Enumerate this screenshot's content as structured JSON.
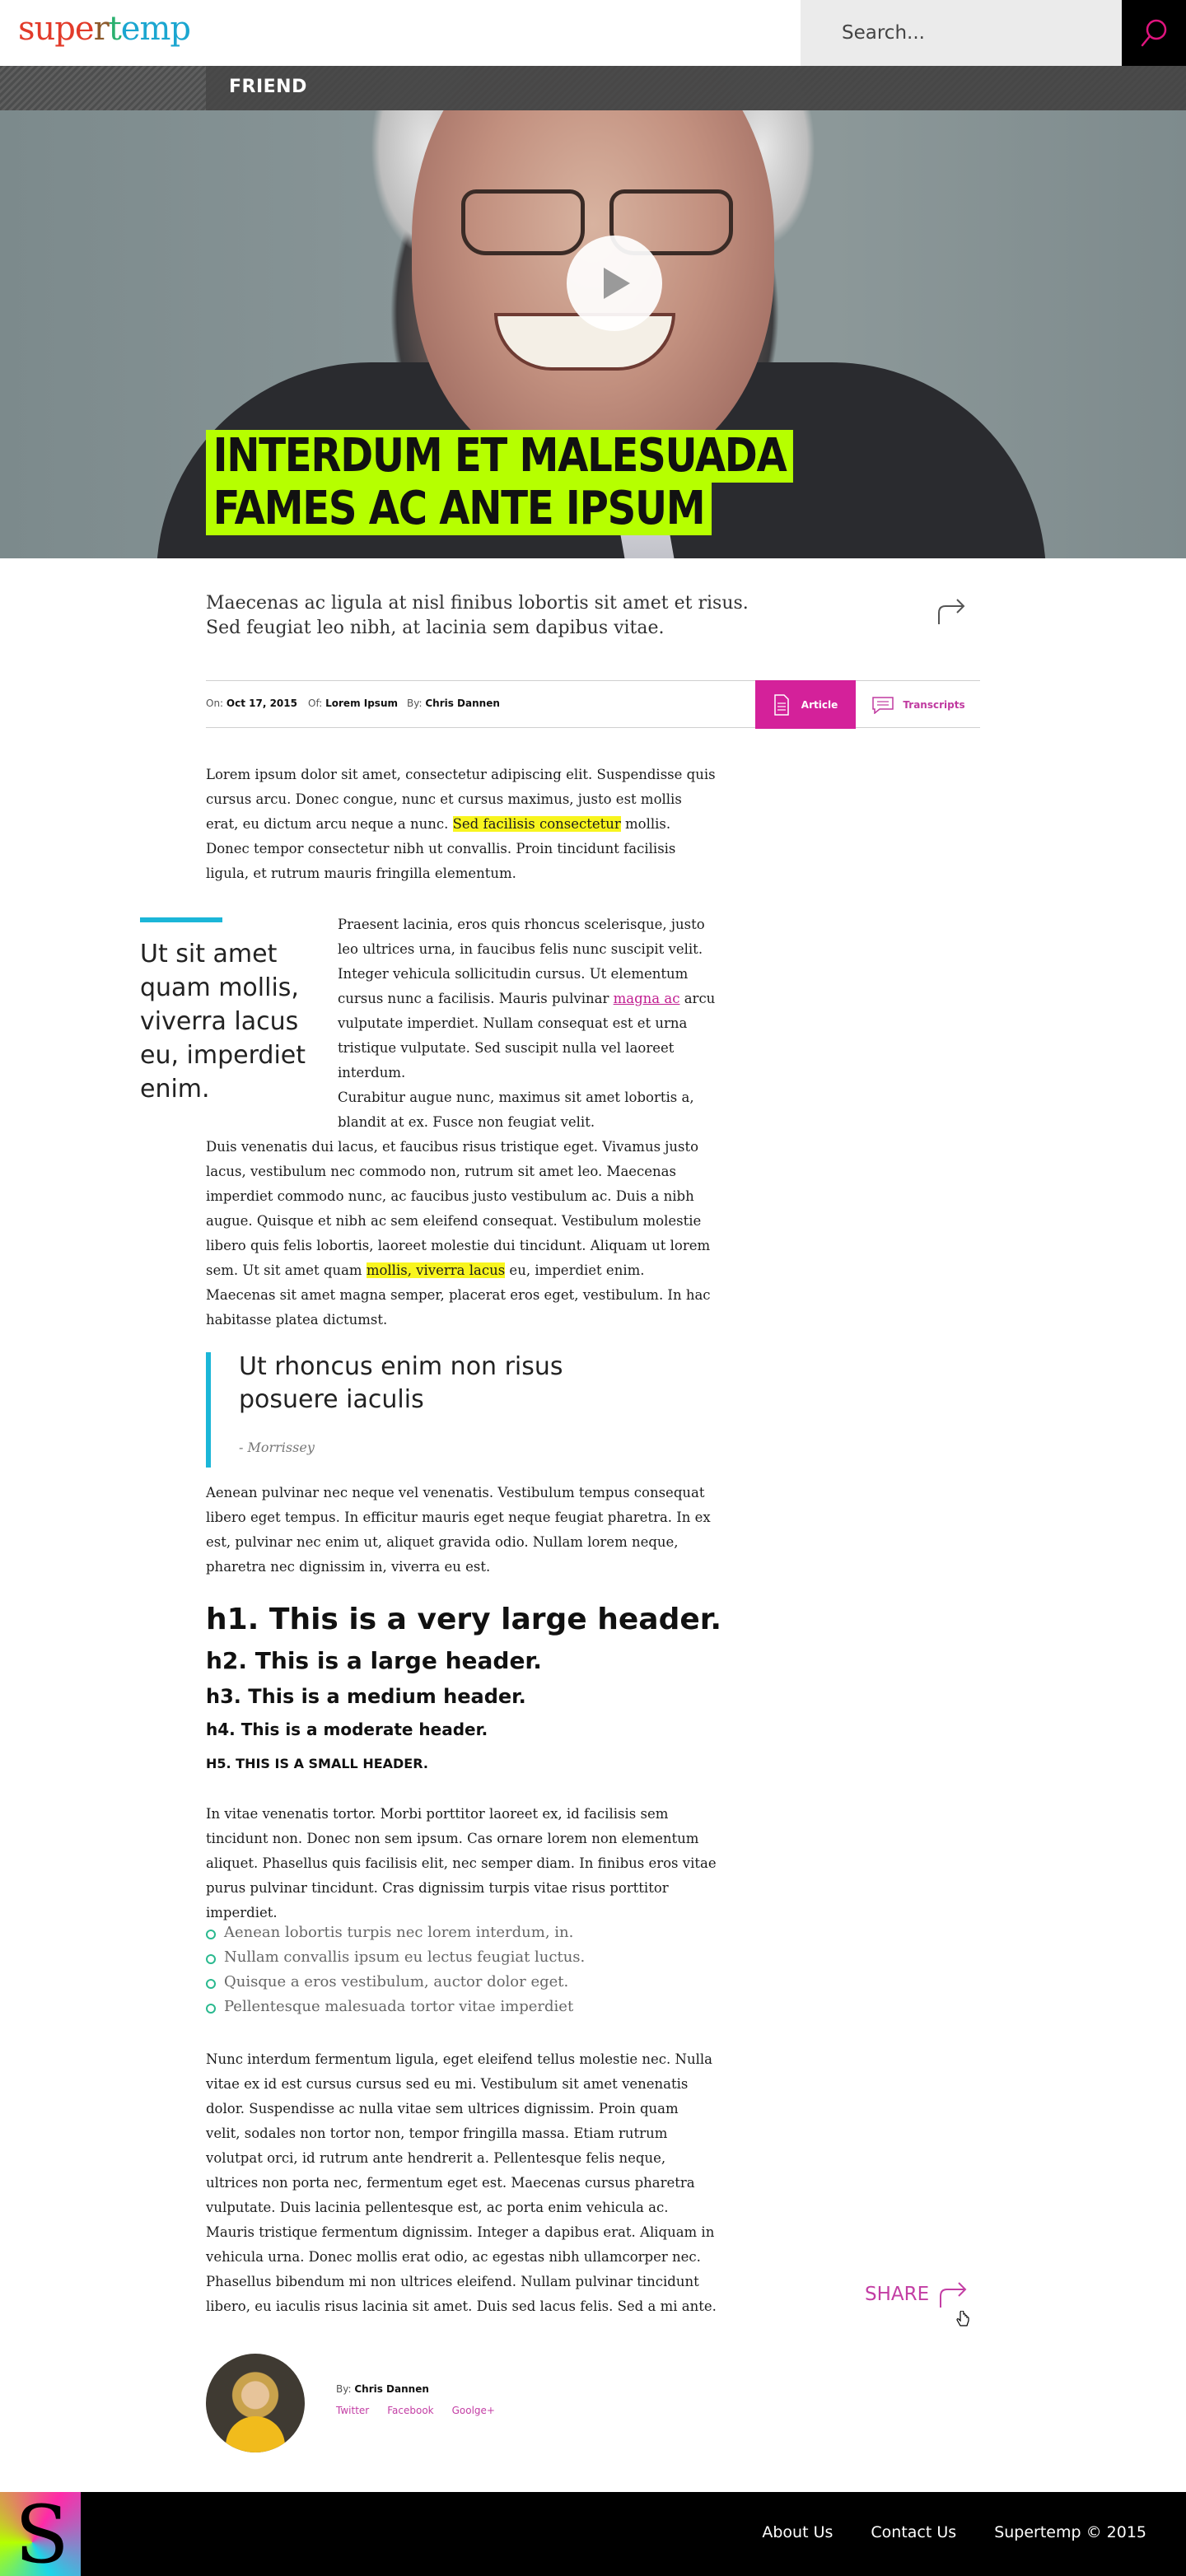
{
  "header": {
    "logo": {
      "text": "supertemp",
      "letters": [
        {
          "ch": "s",
          "color": "#e23b2a"
        },
        {
          "ch": "u",
          "color": "#e23b2a"
        },
        {
          "ch": "p",
          "color": "#e23b2a"
        },
        {
          "ch": "e",
          "color": "#e23b2a"
        },
        {
          "ch": "r",
          "color": "#8c5a2c"
        },
        {
          "ch": "t",
          "color": "#2ab06f"
        },
        {
          "ch": "e",
          "color": "#1ba6d0"
        },
        {
          "ch": "m",
          "color": "#1ba6d0"
        },
        {
          "ch": "p",
          "color": "#1ba6d0"
        }
      ]
    },
    "search_placeholder": "Search...",
    "search_icon": "search-icon",
    "search_icon_color": "#e0147e"
  },
  "hero": {
    "tag": "FRIEND",
    "headline_lines": [
      "INTERDUM ET MALESUADA",
      "FAMES AC ANTE IPSUM"
    ],
    "headline_bg": "#b6ff00",
    "play_icon": "play-icon"
  },
  "intro": {
    "text": "Maecenas ac ligula at nisl finibus lobortis sit amet et risus. Sed feugiat leo nibh, at lacinia sem dapibus vitae.",
    "share_icon": "share-arrow-icon"
  },
  "meta": {
    "on_label": "On:",
    "on_value": "Oct 17, 2015",
    "of_label": "Of:",
    "of_value": "Lorem Ipsum",
    "by_label": "By:",
    "by_value": "Chris Dannen",
    "tabs": {
      "article": "Article",
      "transcripts": "Transcripts"
    },
    "accent": "#d4219a"
  },
  "article": {
    "p1": {
      "before": "Lorem ipsum dolor sit amet, consectetur adipiscing elit. Suspendisse quis cursus arcu. Donec congue, nunc et cursus maximus, justo est mollis erat, eu dictum arcu neque a nunc. ",
      "highlight": "Sed facilisis consectetur",
      "after": " mollis. Donec tempor consectetur nibh ut convallis. Proin tincidunt facilisis ligula, et rutrum mauris fringilla elementum."
    },
    "pullquote": "Ut sit amet quam mollis, viverra lacus eu, imperdiet enim.",
    "p2": {
      "before": "Praesent lacinia, eros quis rhoncus scelerisque, justo leo ultrices urna, in faucibus felis nunc suscipit velit. Integer vehicula sollicitudin cursus. Ut elementum cursus nunc a facilisis. Mauris pulvinar ",
      "link": "magna ac",
      "after": " arcu vulputate imperdiet. Nullam consequat est et urna tristique vulputate. Sed suscipit nulla vel laoreet interdum."
    },
    "p3": {
      "intro": "Curabitur augue nunc, maximus sit amet lobortis a, blandit at ex. Fusce non feugiat velit.",
      "before": "Duis venenatis dui lacus, et faucibus risus tristique eget. Vivamus justo lacus, vestibulum nec commodo non, rutrum sit amet leo. Maecenas imperdiet commodo nunc, ac faucibus justo vestibulum ac. Duis a nibh augue. Quisque et nibh ac sem eleifend consequat. Vestibulum molestie libero quis felis lobortis, laoreet molestie dui tincidunt. Aliquam ut lorem sem. Ut sit amet quam ",
      "highlight": "mollis, viverra lacus",
      "after": " eu, imperdiet enim. Maecenas sit amet magna semper, placerat eros eget, vestibulum. In hac habitasse platea dictumst."
    },
    "blockquote": {
      "text": "Ut rhoncus enim non risus posuere iaculis",
      "cite": "- Morrissey"
    },
    "p4": "Aenean pulvinar nec neque vel venenatis. Vestibulum tempus consequat libero eget tempus. In efficitur mauris eget neque feugiat pharetra. In ex est, pulvinar nec enim ut, aliquet gravida odio. Nullam lorem neque, pharetra nec dignissim in, viverra eu est.",
    "headers": {
      "h1": "h1. This is a very large header.",
      "h2": "h2. This is a large header.",
      "h3": "h3. This is a medium header.",
      "h4": "h4. This is a moderate header.",
      "h5": "h5. This is a small header."
    },
    "p5": "In vitae venenatis tortor. Morbi porttitor laoreet ex, id facilisis sem tincidunt non. Donec non sem ipsum. Cas ornare lorem non elementum aliquet. Phasellus quis facilisis elit, nec semper diam. In finibus eros vitae purus pulvinar tincidunt. Cras dignissim turpis vitae risus porttitor imperdiet.",
    "list": [
      "Aenean lobortis turpis nec lorem interdum, in.",
      "Nullam convallis ipsum eu lectus feugiat luctus.",
      "Quisque a eros vestibulum, auctor dolor eget.",
      "Pellentesque malesuada tortor vitae imperdiet"
    ],
    "p6": "Nunc interdum fermentum ligula, eget eleifend tellus molestie nec. Nulla vitae ex id est cursus cursus sed eu mi. Vestibulum sit amet venenatis dolor. Suspendisse ac nulla vitae sem ultrices dignissim. Proin quam velit, sodales non tortor non, tempor fringilla massa. Etiam rutrum volutpat orci, id rutrum ante hendrerit a. Pellentesque felis neque, ultrices non porta nec, fermentum eget est. Maecenas cursus pharetra vulputate. Duis lacinia pellentesque est, ac porta enim vehicula ac. Mauris tristique fermentum dignissim. Integer a dapibus erat. Aliquam in vehicula urna. Donec mollis erat odio, ac egestas nibh ullamcorper nec. Phasellus bibendum mi non ultrices eleifend. Nullam pulvinar tincidunt libero, eu iaculis risus lacinia sit amet. Duis sed lacus felis. Sed a mi ante.",
    "share_label": "SHARE"
  },
  "author": {
    "by_label": "By:",
    "name": "Chris Dannen",
    "social": [
      "Twitter",
      "Facebook",
      "Goolge+"
    ]
  },
  "footer": {
    "logo_letter": "S",
    "links": [
      "About Us",
      "Contact Us",
      "Supertemp © 2015"
    ]
  }
}
